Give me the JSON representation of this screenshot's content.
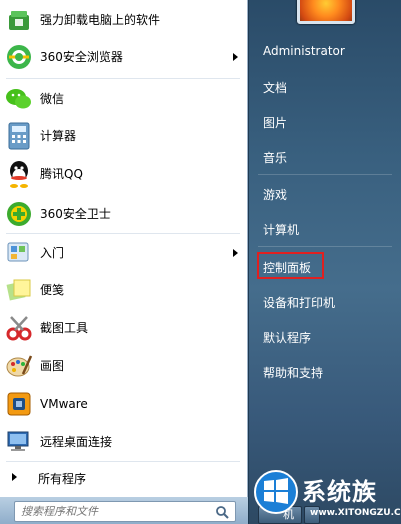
{
  "programs": [
    {
      "label": "强力卸载电脑上的软件",
      "icon": "uninstall-icon",
      "has_arrow": false
    },
    {
      "label": "360安全浏览器",
      "icon": "360-browser-icon",
      "has_arrow": true
    },
    {
      "label": "微信",
      "icon": "wechat-icon",
      "has_arrow": false
    },
    {
      "label": "计算器",
      "icon": "calculator-icon",
      "has_arrow": false
    },
    {
      "label": "腾讯QQ",
      "icon": "qq-icon",
      "has_arrow": false
    },
    {
      "label": "360安全卫士",
      "icon": "360-guard-icon",
      "has_arrow": false
    },
    {
      "label": "入门",
      "icon": "getting-started-icon",
      "has_arrow": true
    },
    {
      "label": "便笺",
      "icon": "sticky-notes-icon",
      "has_arrow": false
    },
    {
      "label": "截图工具",
      "icon": "snipping-tool-icon",
      "has_arrow": false
    },
    {
      "label": "画图",
      "icon": "paint-icon",
      "has_arrow": false
    },
    {
      "label": "VMware",
      "icon": "vmware-icon",
      "has_arrow": false
    },
    {
      "label": "远程桌面连接",
      "icon": "remote-desktop-icon",
      "has_arrow": false
    }
  ],
  "all_programs": "所有程序",
  "search": {
    "placeholder": "搜索程序和文件"
  },
  "right_links": {
    "user": "Administrator",
    "documents": "文档",
    "pictures": "图片",
    "music": "音乐",
    "games": "游戏",
    "computer": "计算机",
    "control_panel": "控制面板",
    "devices_printers": "设备和打印机",
    "default_programs": "默认程序",
    "help_support": "帮助和支持"
  },
  "shutdown_label": "机",
  "watermark": {
    "text": "系统族",
    "url": "www.XITONGZU.COM"
  },
  "colors": {
    "highlight": "#e02020",
    "accent": "#3a6286"
  }
}
